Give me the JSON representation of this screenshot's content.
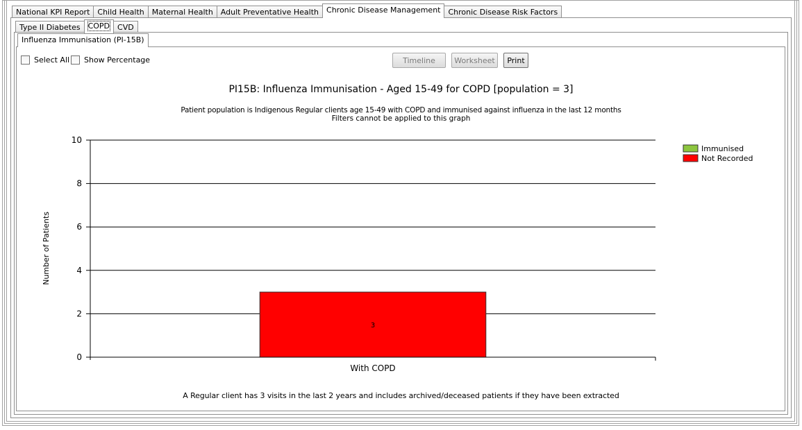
{
  "top_tabs": [
    {
      "label": "National KPI Report",
      "active": false
    },
    {
      "label": "Child Health",
      "active": false
    },
    {
      "label": "Maternal Health",
      "active": false
    },
    {
      "label": "Adult Preventative Health",
      "active": false
    },
    {
      "label": "Chronic Disease Management",
      "active": true
    },
    {
      "label": "Chronic Disease Risk Factors",
      "active": false
    }
  ],
  "sub_tabs": [
    {
      "label": "Type II Diabetes",
      "active": false
    },
    {
      "label": "COPD",
      "active": true
    },
    {
      "label": "CVD",
      "active": false
    }
  ],
  "indicator_tab": {
    "label": "Influenza Immunisation (PI-15B)"
  },
  "options": {
    "select_all_label": "Select All",
    "select_all_checked": false,
    "show_percentage_label": "Show Percentage",
    "show_percentage_checked": false
  },
  "buttons": {
    "timeline_label": "Timeline",
    "worksheet_label": "Worksheet",
    "print_label": "Print"
  },
  "chart_data": {
    "type": "bar",
    "title": "PI15B: Influenza Immunisation - Aged 15-49 for COPD [population = 3]",
    "subtitle_line1": "Patient population is Indigenous Regular clients age 15-49 with COPD and immunised against influenza in the last 12 months",
    "subtitle_line2": "Filters cannot be applied to this graph",
    "ylabel": "Number of Patients",
    "xlabel": "",
    "ylim": [
      0,
      10
    ],
    "yticks": [
      0,
      2,
      4,
      6,
      8,
      10
    ],
    "grid": true,
    "stacked": true,
    "categories": [
      "With COPD"
    ],
    "series": [
      {
        "name": "Immunised",
        "values": [
          0
        ],
        "color": "#8dc63f"
      },
      {
        "name": "Not Recorded",
        "values": [
          3
        ],
        "color": "#ff0000"
      }
    ],
    "data_labels": [
      "3"
    ],
    "legend_position": "right",
    "footnote": "A Regular client has 3 visits in the last 2 years and includes archived/deceased patients if they have been extracted"
  }
}
